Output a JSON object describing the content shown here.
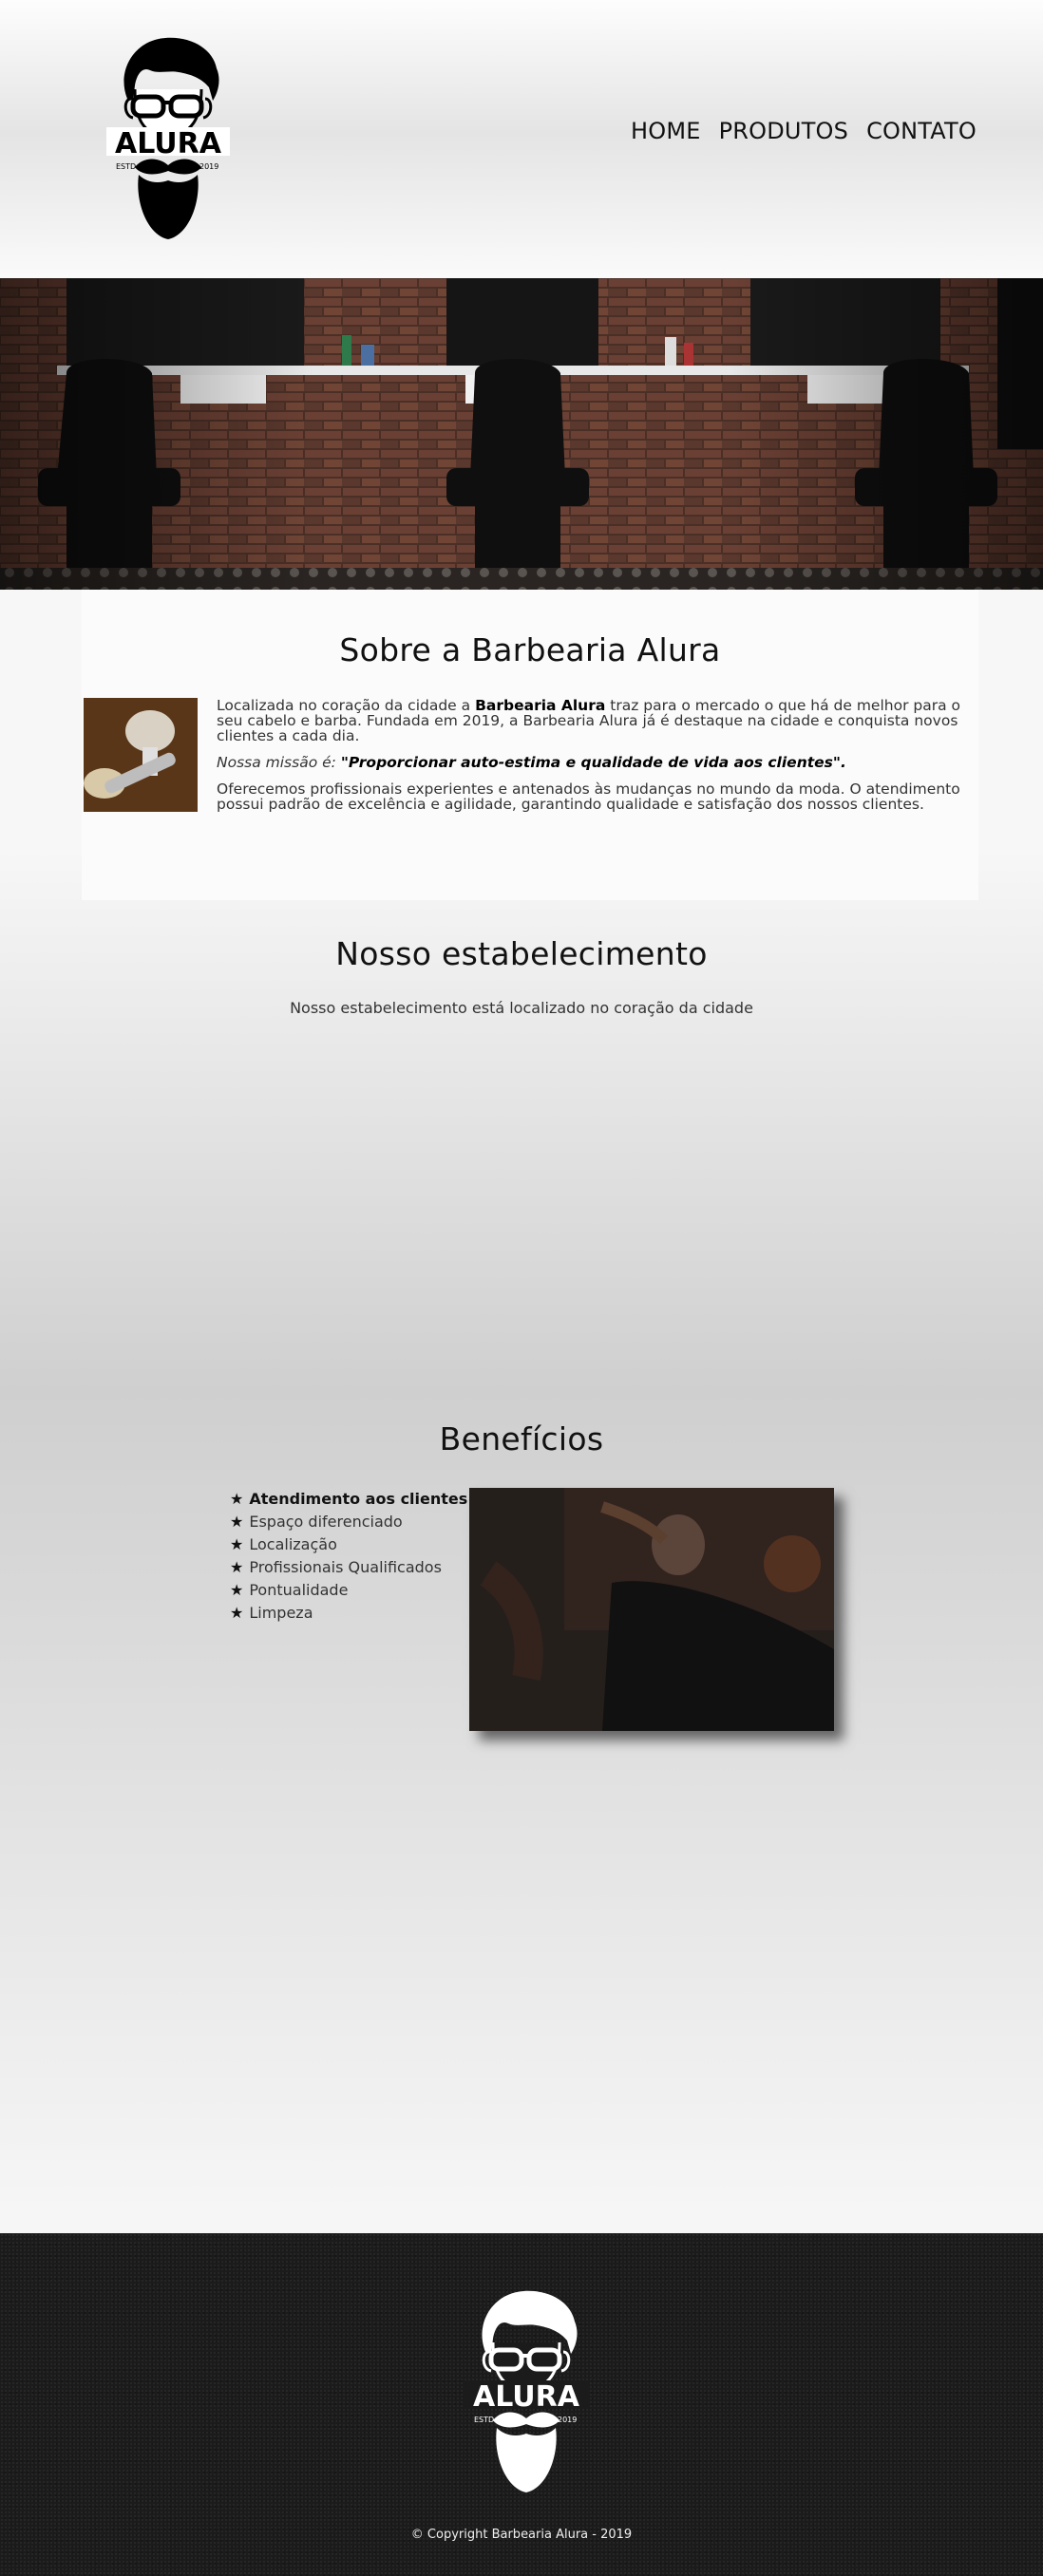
{
  "brand": {
    "logo_text": "ALURA",
    "logo_estd": "ESTD",
    "logo_year": "2019"
  },
  "nav": {
    "items": [
      {
        "label": "HOME"
      },
      {
        "label": "PRODUTOS"
      },
      {
        "label": "CONTATO"
      }
    ]
  },
  "about": {
    "title": "Sobre a Barbearia Alura",
    "p1_before": "Localizada no coração da cidade a ",
    "p1_bold": "Barbearia Alura",
    "p1_after": " traz para o mercado o que há de melhor para o seu cabelo e barba. Fundada em 2019, a Barbearia Alura já é destaque na cidade e conquista novos clientes a cada dia.",
    "mission_lead": "Nossa missão é: ",
    "mission_quote": "\"Proporcionar auto-estima e qualidade de vida aos clientes\".",
    "p3": "Oferecemos profissionais experientes e antenados às mudanças no mundo da moda. O atendimento possui padrão de excelência e agilidade, garantindo qualidade e satisfação dos nossos clientes."
  },
  "establishment": {
    "title": "Nosso estabelecimento",
    "subtitle": "Nosso estabelecimento está localizado no coração da cidade"
  },
  "benefits": {
    "title": "Benefícios",
    "star": "★",
    "items": [
      "Atendimento aos clientes",
      "Espaço diferenciado",
      "Localização",
      "Profissionais Qualificados",
      "Pontualidade",
      "Limpeza"
    ]
  },
  "footer": {
    "copyright": "© Copyright Barbearia Alura - 2019"
  },
  "colors": {
    "footer_bg": "#1b1b1b",
    "text": "#222222",
    "heading": "#111111"
  }
}
